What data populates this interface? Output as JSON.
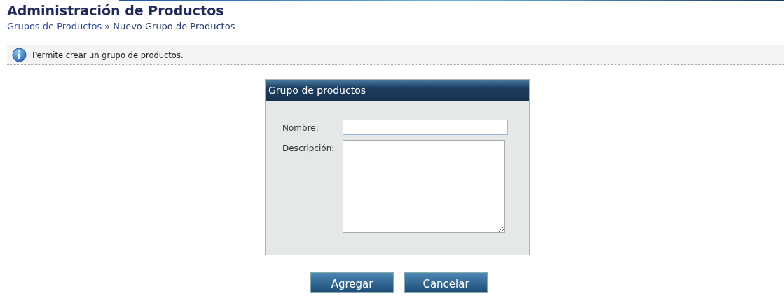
{
  "page": {
    "title": "Administración de Productos"
  },
  "breadcrumb": [
    {
      "label": "Grupos de Productos",
      "kind": "link"
    },
    {
      "label": "»",
      "kind": "separator"
    },
    {
      "label": "Nuevo Grupo de Productos",
      "kind": "current"
    }
  ],
  "info": {
    "message": "Permite crear un grupo de productos."
  },
  "form": {
    "title": "Grupo de productos",
    "fields": [
      {
        "label": "Nombre:",
        "kind": "text"
      },
      {
        "label": "Descripción:",
        "kind": "textarea"
      }
    ]
  },
  "buttons": [
    "Agregar",
    "Cancelar"
  ]
}
